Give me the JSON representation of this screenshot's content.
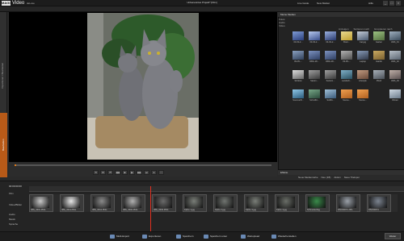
{
  "titlebar": {
    "logo": "MAGIX",
    "app_name": "Video",
    "app_version": "deLuxe",
    "doc_title": "Unbenanntes Projekt* [Film]",
    "live_guide": "Live Guide",
    "new_market": "New Market",
    "help": "Hilfe",
    "window_min": "_",
    "window_max": "□",
    "window_close": "×"
  },
  "left_tabs": {
    "upper": "Importieren / Bearbeiten",
    "lower": "Bearbeiten"
  },
  "media": {
    "header": "Meine Medien",
    "tree": [
      "Fotos",
      "Audio",
      "Video"
    ],
    "toolbar": [
      "Anzeigen",
      "Sortieren nach",
      "Gruppieren nach"
    ],
    "thumbs": [
      "03-03-2...",
      "03-03-2...",
      "04-03-2...",
      "Brett...",
      "Cat.jpg",
      "Garten",
      "Wdb_01",
      "09-05-...",
      "DBG-18...",
      "DBG-18...",
      "03-05-...",
      "Laptop",
      "Gardin",
      "Wdb_02",
      "Schloss",
      "Saturn...",
      "Sarturn...",
      "Landsch...",
      "Lifestyle",
      "Pferd",
      "Wdb_03",
      "Sommer8...",
      "Sch-Mitt...",
      "Sd-Bit...",
      "Sonne...",
      "Sonne...",
      "",
      "Winter"
    ]
  },
  "effects_bar": "Effekte",
  "timeline_toolbar": [
    "Neue Medienreihe",
    "Neu (F8)",
    "Aktion",
    "Neue Titelspur"
  ],
  "timeline": {
    "timecode": "00:00:00:00",
    "tracks": [
      "Film",
      "Video/Bilder",
      "Audio",
      "Musik",
      "Sprache"
    ],
    "clips": [
      "IMG_0001.PNG",
      "IMG_0011.PNG",
      "IMG_0012.PNG",
      "IMG_0002.PNG",
      "IMG_0003.PNG",
      "Katze 1.jpg",
      "Katze 2.jpg",
      "Katze 3.jpg",
      "Katze 4.jpg",
      "Schmetterling",
      "DSC00073.JPG",
      "DSC00074"
    ]
  },
  "bottom": {
    "buttons": [
      "Multi-Export",
      "Exportieren",
      "Speichern",
      "Speichern unter",
      "Webupload",
      "Wiederherstellen"
    ],
    "next": "Weiter"
  },
  "colors": {
    "accent": "#e07b1a",
    "playhead": "#e03020"
  }
}
